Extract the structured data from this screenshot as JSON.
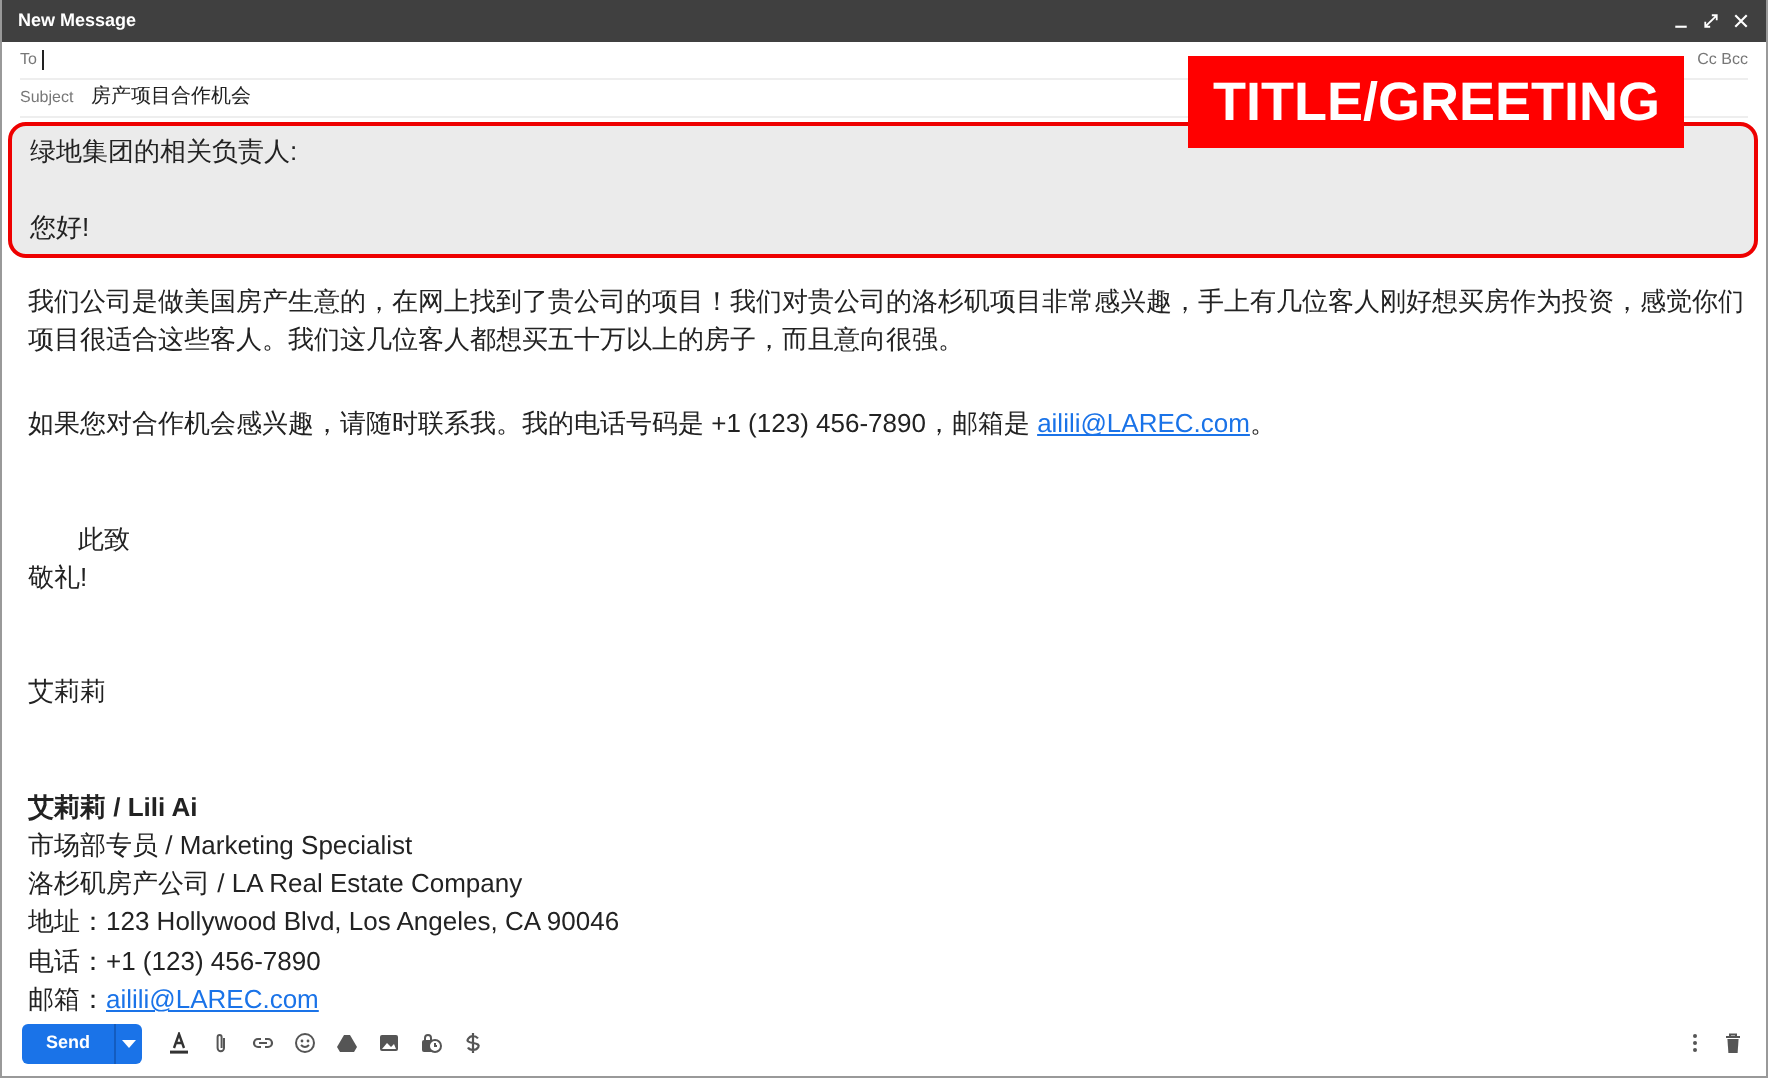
{
  "window": {
    "title": "New Message"
  },
  "to": {
    "label": "To",
    "cc_bcc": "Cc Bcc"
  },
  "subject": {
    "label": "Subject",
    "value": "房产项目合作机会"
  },
  "annotation": {
    "label": "TITLE/GREETING"
  },
  "greeting": [
    "绿地集团的相关负责人:",
    "您好!"
  ],
  "paragraphs": [
    {
      "text": "我们公司是做美国房产生意的，在网上找到了贵公司的项目！我们对贵公司的洛杉矶项目非常感兴趣，手上有几位客人刚好想买房作为投资，感觉你们项目很适合这些客人。我们这几位客人都想买五十万以上的房子，而且意向很强。"
    },
    {
      "text": "如果您对合作机会感兴趣，请随时联系我。我的电话号码是 +1 (123) 456-7890，邮箱是 ",
      "link": "ailili@LAREC.com",
      "after": "。"
    }
  ],
  "closing": [
    "此致",
    "敬礼!"
  ],
  "name": "艾莉莉",
  "signature": [
    {
      "text": "艾莉莉 / Lili Ai",
      "bold": true
    },
    {
      "text": "市场部专员 / Marketing Specialist",
      "bold": false
    },
    {
      "text": "洛杉矶房产公司 / LA Real Estate Company",
      "bold": false
    },
    {
      "text": "地址：123 Hollywood Blvd, Los Angeles, CA 90046",
      "bold": false
    },
    {
      "text": "电话：+1 (123) 456-7890",
      "bold": false
    },
    {
      "text": "邮箱：",
      "link": "ailili@LAREC.com",
      "bold": false
    }
  ],
  "toolbar": {
    "send": "Send"
  }
}
